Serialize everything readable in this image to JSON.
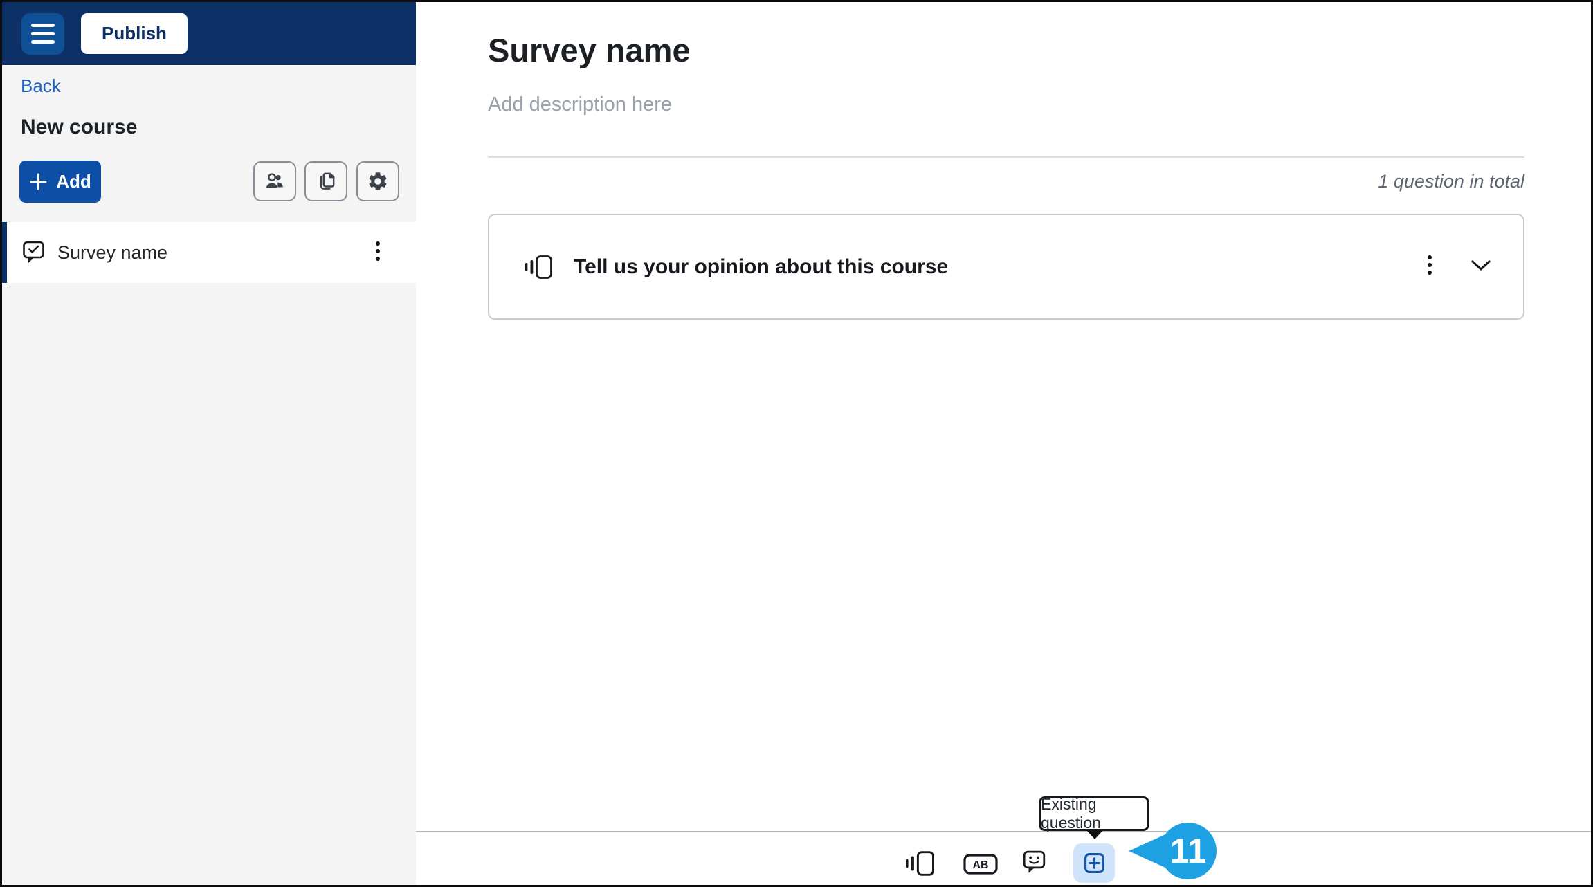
{
  "header": {
    "publish_label": "Publish"
  },
  "sidebar": {
    "back_label": "Back",
    "course_title": "New course",
    "add_button": {
      "label": "Add",
      "icon": "plus-icon"
    },
    "tools": [
      {
        "icon": "collaborators-icon"
      },
      {
        "icon": "duplicate-icon"
      },
      {
        "icon": "settings-gear-icon"
      }
    ],
    "items": [
      {
        "label": "Survey name",
        "icon": "survey-bubble-check-icon",
        "selected": true
      }
    ]
  },
  "main": {
    "title": "Survey name",
    "description_placeholder": "Add description here",
    "questions_summary": "1 question in total",
    "questions": [
      {
        "title": "Tell us your opinion about this course",
        "type_icon": "likert-scale-icon"
      }
    ]
  },
  "bottom_toolbar": {
    "tooltip": {
      "label": "Existing question"
    },
    "items": [
      {
        "icon": "likert-scale-icon"
      },
      {
        "icon": "single-choice-ab-icon",
        "glyph": "AB"
      },
      {
        "icon": "feedback-comment-icon"
      },
      {
        "icon": "existing-question-add-icon",
        "highlighted": true
      }
    ]
  },
  "annotation": {
    "step_number": "11"
  },
  "colors": {
    "header_navy": "#0d3166",
    "hamburger_blue": "#0f4f96",
    "accent_blue": "#0d4fa6",
    "link_blue": "#1f62c5",
    "sidebar_bg": "#f4f4f5",
    "toolbar_highlight": "#cfe4fb",
    "add_icon_blue": "#1457a8",
    "annotation_blue": "#1da1e2"
  }
}
